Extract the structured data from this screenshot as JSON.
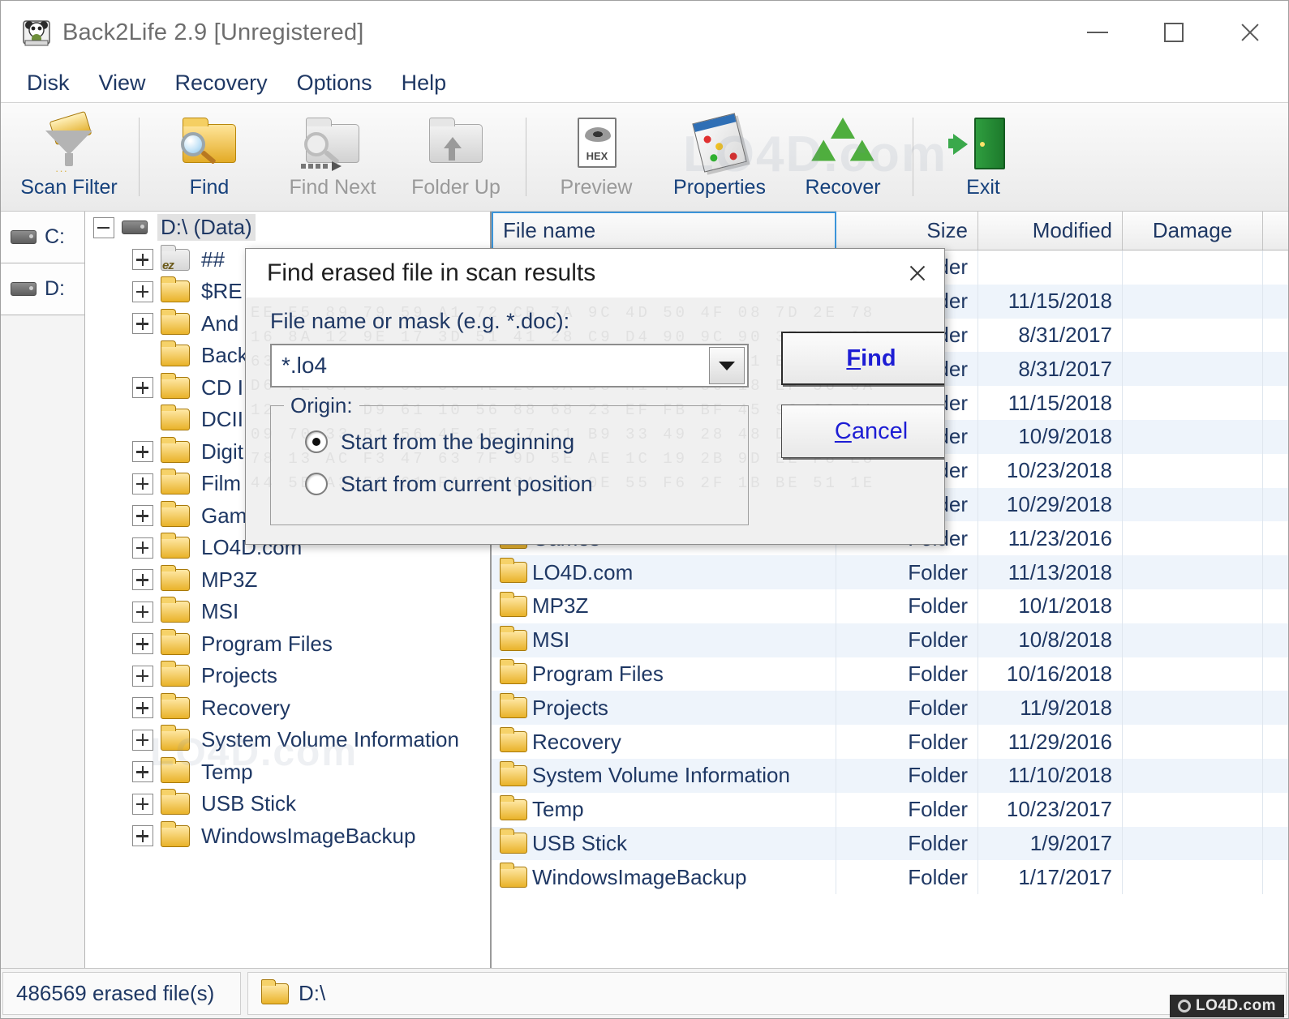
{
  "window": {
    "title": "Back2Life 2.9 [Unregistered]",
    "app_icon": "panda-icon",
    "minimize_label": "Minimize",
    "maximize_label": "Maximize",
    "close_label": "Close"
  },
  "menu": {
    "items": [
      {
        "label": "Disk"
      },
      {
        "label": "View"
      },
      {
        "label": "Recovery"
      },
      {
        "label": "Options"
      },
      {
        "label": "Help"
      }
    ]
  },
  "toolbar": {
    "buttons": [
      {
        "label": "Scan Filter",
        "icon": "scan-filter-icon",
        "disabled": false
      },
      {
        "label": "Find",
        "icon": "find-folder-icon",
        "disabled": false
      },
      {
        "label": "Find Next",
        "icon": "find-next-icon",
        "disabled": true
      },
      {
        "label": "Folder Up",
        "icon": "folder-up-icon",
        "disabled": true
      },
      {
        "label": "Preview",
        "icon": "hex-preview-icon",
        "disabled": true
      },
      {
        "label": "Properties",
        "icon": "properties-icon",
        "disabled": false
      },
      {
        "label": "Recover",
        "icon": "recycle-icon",
        "disabled": false
      },
      {
        "label": "Exit",
        "icon": "exit-door-icon",
        "disabled": false
      }
    ]
  },
  "drives": {
    "items": [
      {
        "label": "C:",
        "icon": "hard-drive-icon"
      },
      {
        "label": "D:",
        "icon": "hard-drive-icon"
      }
    ]
  },
  "tree": {
    "root": {
      "label": "D:\\ (Data)",
      "icon": "hard-drive-icon",
      "expander": "minus"
    },
    "items": [
      {
        "label": "## ",
        "expander": "plus",
        "icon": "erased-folder-icon"
      },
      {
        "label": "$RE",
        "expander": "plus",
        "icon": "folder-icon"
      },
      {
        "label": "And",
        "expander": "plus",
        "icon": "folder-icon"
      },
      {
        "label": "Back",
        "expander": "none",
        "icon": "folder-icon"
      },
      {
        "label": "CD I",
        "expander": "plus",
        "icon": "folder-icon"
      },
      {
        "label": "DCII",
        "expander": "none",
        "icon": "folder-icon"
      },
      {
        "label": "Digit",
        "expander": "plus",
        "icon": "folder-icon"
      },
      {
        "label": "Film",
        "expander": "plus",
        "icon": "folder-icon"
      },
      {
        "label": "Gam",
        "expander": "plus",
        "icon": "folder-icon"
      },
      {
        "label": "LO4D.com",
        "expander": "plus",
        "icon": "folder-icon"
      },
      {
        "label": "MP3Z",
        "expander": "plus",
        "icon": "folder-icon"
      },
      {
        "label": "MSI",
        "expander": "plus",
        "icon": "folder-icon"
      },
      {
        "label": "Program Files",
        "expander": "plus",
        "icon": "folder-icon"
      },
      {
        "label": "Projects",
        "expander": "plus",
        "icon": "folder-icon"
      },
      {
        "label": "Recovery",
        "expander": "plus",
        "icon": "folder-icon"
      },
      {
        "label": "System Volume Information",
        "expander": "plus",
        "icon": "folder-icon"
      },
      {
        "label": "Temp",
        "expander": "plus",
        "icon": "folder-icon"
      },
      {
        "label": "USB Stick",
        "expander": "plus",
        "icon": "folder-icon"
      },
      {
        "label": "WindowsImageBackup",
        "expander": "plus",
        "icon": "folder-icon"
      }
    ]
  },
  "filelist": {
    "columns": [
      {
        "key": "name",
        "label": "File name",
        "selected": true
      },
      {
        "key": "size",
        "label": "Size",
        "selected": false
      },
      {
        "key": "modified",
        "label": "Modified",
        "selected": false
      },
      {
        "key": "damage",
        "label": "Damage",
        "selected": false
      }
    ],
    "rows": [
      {
        "name": "",
        "size": "Folder",
        "modified": "",
        "damage": ""
      },
      {
        "name": "",
        "size": "Folder",
        "modified": "11/15/2018",
        "damage": ""
      },
      {
        "name": "",
        "size": "Folder",
        "modified": "8/31/2017",
        "damage": ""
      },
      {
        "name": "",
        "size": "Folder",
        "modified": "8/31/2017",
        "damage": ""
      },
      {
        "name": "",
        "size": "Folder",
        "modified": "11/15/2018",
        "damage": ""
      },
      {
        "name": "",
        "size": "Folder",
        "modified": "10/9/2018",
        "damage": ""
      },
      {
        "name": "",
        "size": "Folder",
        "modified": "10/23/2018",
        "damage": ""
      },
      {
        "name": "",
        "size": "Folder",
        "modified": "10/29/2018",
        "damage": ""
      },
      {
        "name": "Games",
        "size": "Folder",
        "modified": "11/23/2016",
        "damage": ""
      },
      {
        "name": "LO4D.com",
        "size": "Folder",
        "modified": "11/13/2018",
        "damage": ""
      },
      {
        "name": "MP3Z",
        "size": "Folder",
        "modified": "10/1/2018",
        "damage": ""
      },
      {
        "name": "MSI",
        "size": "Folder",
        "modified": "10/8/2018",
        "damage": ""
      },
      {
        "name": "Program Files",
        "size": "Folder",
        "modified": "10/16/2018",
        "damage": ""
      },
      {
        "name": "Projects",
        "size": "Folder",
        "modified": "11/9/2018",
        "damage": ""
      },
      {
        "name": "Recovery",
        "size": "Folder",
        "modified": "11/29/2016",
        "damage": ""
      },
      {
        "name": "System Volume Information",
        "size": "Folder",
        "modified": "11/10/2018",
        "damage": ""
      },
      {
        "name": "Temp",
        "size": "Folder",
        "modified": "10/23/2017",
        "damage": ""
      },
      {
        "name": "USB Stick",
        "size": "Folder",
        "modified": "1/9/2017",
        "damage": ""
      },
      {
        "name": "WindowsImageBackup",
        "size": "Folder",
        "modified": "1/17/2017",
        "damage": ""
      }
    ]
  },
  "statusbar": {
    "erased_count": "486569  erased file(s)",
    "current_path": "D:\\",
    "path_icon": "folder-icon"
  },
  "dialog": {
    "title": "Find erased file in scan results",
    "close_label": "Close",
    "field_label": "File name or mask (e.g.   *.doc):",
    "mask_value": "*.lo4",
    "dropdown_icon": "chevron-down-icon",
    "origin": {
      "caption": "Origin:",
      "options": [
        {
          "label": "Start from the beginning",
          "selected": true
        },
        {
          "label": "Start from current position",
          "selected": false
        }
      ]
    },
    "buttons": {
      "find": {
        "label": "Find",
        "accel": "F",
        "default": true
      },
      "cancel": {
        "label": "Cancel",
        "accel": "C",
        "default": false
      }
    }
  },
  "watermark": {
    "text": "LO4D.com"
  },
  "colors": {
    "text_blue": "#1f3864",
    "link_blue": "#1d1dd4",
    "row_alt": "#eef4fb",
    "accent": "#3b94d9"
  }
}
